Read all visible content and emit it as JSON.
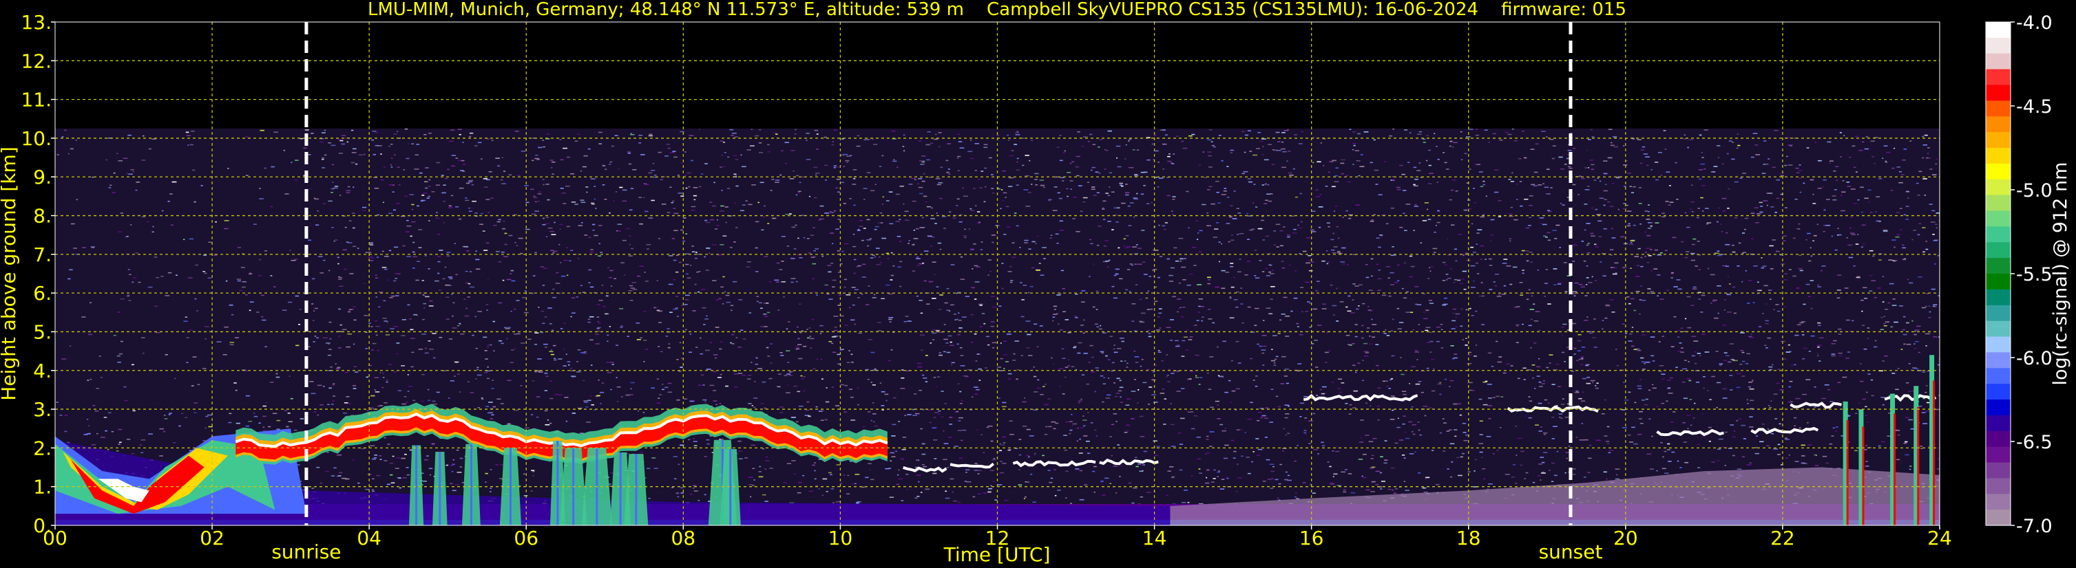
{
  "chart_data": {
    "type": "heatmap",
    "title": "LMU-MIM, Munich, Germany; 48.148° N 11.573° E, altitude: 539 m    Campbell SkyVUEPRO CS135 (CS135LMU): 16-06-2024    firmware: 015",
    "xlabel": "Time [UTC]",
    "ylabel": "Height above ground [km]",
    "colorbar_label": "log(rc-signal) @ 912 nm",
    "xlim": [
      0,
      24
    ],
    "ylim": [
      0,
      13
    ],
    "x_ticks": [
      0,
      2,
      4,
      6,
      8,
      10,
      12,
      14,
      16,
      18,
      20,
      22,
      24
    ],
    "x_tick_labels": [
      "00",
      "02",
      "04",
      "06",
      "08",
      "10",
      "12",
      "14",
      "16",
      "18",
      "20",
      "22",
      "24"
    ],
    "y_ticks": [
      0,
      1,
      2,
      3,
      4,
      5,
      6,
      7,
      8,
      9,
      10,
      11,
      12,
      13
    ],
    "y_tick_labels": [
      "0.",
      "1.",
      "2.",
      "3.",
      "4.",
      "5.",
      "6.",
      "7.",
      "8.",
      "9.",
      "10.",
      "11.",
      "12.",
      "13."
    ],
    "grid": true,
    "colorbar": {
      "range": [
        -7.0,
        -4.0
      ],
      "ticks": [
        -4.0,
        -4.5,
        -5.0,
        -5.5,
        -6.0,
        -6.5,
        -7.0
      ],
      "tick_labels": [
        "-4.0",
        "-4.5",
        "-5.0",
        "-5.5",
        "-6.0",
        "-6.5",
        "-7.0"
      ],
      "colors": [
        "#ffffff",
        "#f3e6e6",
        "#e8c4c8",
        "#ff3030",
        "#ff0000",
        "#ff5a00",
        "#ff8c00",
        "#ffb000",
        "#ffd800",
        "#ffff00",
        "#d8f040",
        "#a8e060",
        "#70d880",
        "#40c890",
        "#20b070",
        "#109030",
        "#008000",
        "#008a70",
        "#30a0a0",
        "#60c0c0",
        "#a0c8ff",
        "#8090ff",
        "#4a6aff",
        "#2040ff",
        "#0000d0",
        "#3000a0",
        "#550088",
        "#6a1090",
        "#7a3c98",
        "#8a5aa0",
        "#9a78a8",
        "#a890a8"
      ]
    },
    "events": [
      {
        "label": "sunrise",
        "time": 3.2
      },
      {
        "label": "sunset",
        "time": 19.3
      }
    ]
  },
  "colors": {
    "background": "#000000",
    "text": "#ffff00",
    "grid": "#c8c800",
    "event_line": "#ffffff"
  }
}
